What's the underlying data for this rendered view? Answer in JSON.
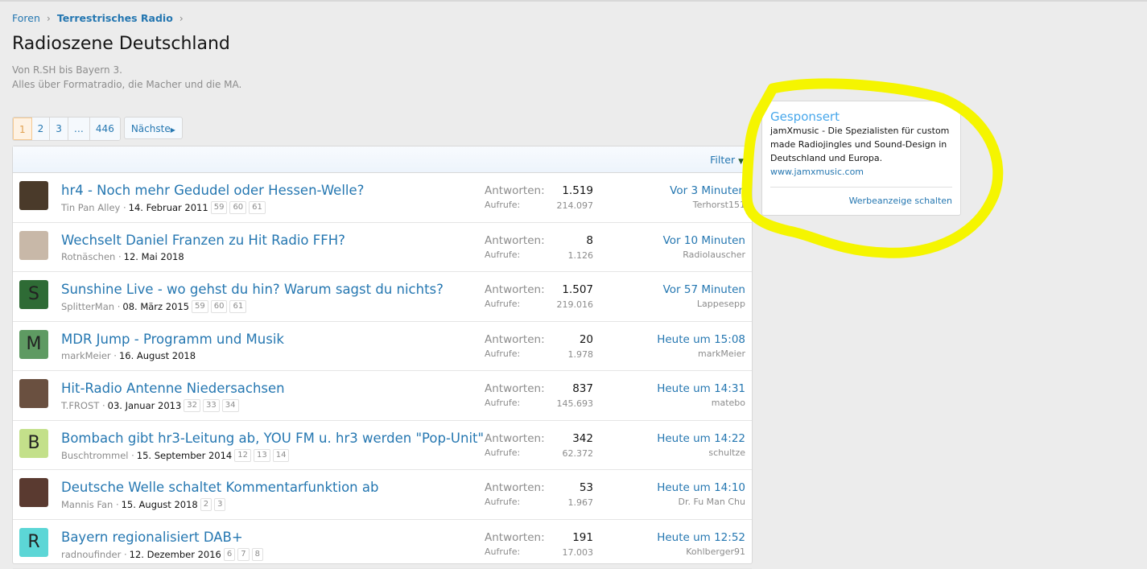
{
  "breadcrumb": [
    "Foren",
    "Terrestrisches Radio"
  ],
  "title": "Radioszene Deutschland",
  "description": [
    "Von R.SH bis Bayern 3.",
    "Alles über Formatradio, die Macher und die MA."
  ],
  "pager": {
    "pages": [
      "1",
      "2",
      "3",
      "…",
      "446"
    ],
    "next": "Nächste"
  },
  "filter": "Filter",
  "labels": {
    "replies": "Antworten:",
    "views": "Aufrufe:"
  },
  "threads": [
    {
      "title": "hr4 - Noch mehr Gedudel oder Hessen-Welle?",
      "author": "Tin Pan Alley",
      "date": "14. Februar 2011",
      "pages": [
        "59",
        "60",
        "61"
      ],
      "replies": "1.519",
      "views": "214.097",
      "last_time": "Vor 3 Minuten",
      "last_user": "Terhorst151",
      "avatar": "",
      "color": "#4a3a2a"
    },
    {
      "title": "Wechselt Daniel Franzen zu Hit Radio FFH?",
      "author": "Rotnäschen",
      "date": "12. Mai 2018",
      "pages": [],
      "replies": "8",
      "views": "1.126",
      "last_time": "Vor 10 Minuten",
      "last_user": "Radiolauscher",
      "avatar": "",
      "color": "#c8b8a8"
    },
    {
      "title": "Sunshine Live - wo gehst du hin? Warum sagst du nichts?",
      "author": "SplitterMan",
      "date": "08. März 2015",
      "pages": [
        "59",
        "60",
        "61"
      ],
      "replies": "1.507",
      "views": "219.016",
      "last_time": "Vor 57 Minuten",
      "last_user": "Lappesepp",
      "avatar": "S",
      "color": "#2e6b35"
    },
    {
      "title": "MDR Jump - Programm und Musik",
      "author": "markMeier",
      "date": "16. August 2018",
      "pages": [],
      "replies": "20",
      "views": "1.978",
      "last_time": "Heute um 15:08",
      "last_user": "markMeier",
      "avatar": "M",
      "color": "#5e9a62"
    },
    {
      "title": "Hit-Radio Antenne Niedersachsen",
      "author": "T.FROST",
      "date": "03. Januar 2013",
      "pages": [
        "32",
        "33",
        "34"
      ],
      "replies": "837",
      "views": "145.693",
      "last_time": "Heute um 14:31",
      "last_user": "matebo",
      "avatar": "",
      "color": "#6a5040"
    },
    {
      "title": "Bombach gibt hr3-Leitung ab, YOU FM u. hr3 werden \"Pop-Unit\"",
      "author": "Buschtrommel",
      "date": "15. September 2014",
      "pages": [
        "12",
        "13",
        "14"
      ],
      "replies": "342",
      "views": "62.372",
      "last_time": "Heute um 14:22",
      "last_user": "schultze",
      "avatar": "B",
      "color": "#c3e08a"
    },
    {
      "title": "Deutsche Welle schaltet Kommentarfunktion ab",
      "author": "Mannis Fan",
      "date": "15. August 2018",
      "pages": [
        "2",
        "3"
      ],
      "replies": "53",
      "views": "1.967",
      "last_time": "Heute um 14:10",
      "last_user": "Dr. Fu Man Chu",
      "avatar": "",
      "color": "#5a3a30"
    },
    {
      "title": "Bayern regionalisiert DAB+",
      "author": "radnoufinder",
      "date": "12. Dezember 2016",
      "pages": [
        "6",
        "7",
        "8"
      ],
      "replies": "191",
      "views": "17.003",
      "last_time": "Heute um 12:52",
      "last_user": "Kohlberger91",
      "avatar": "R",
      "color": "#5cd6d6"
    }
  ],
  "ad": {
    "heading": "Gesponsert",
    "text": "jamXmusic - Die Spezialisten für custom made Radiojingles und Sound-Design in Deutschland und Europa.",
    "url": "www.jamxmusic.com",
    "cta": "Werbeanzeige schalten"
  },
  "highlight_color": "#f5f500"
}
